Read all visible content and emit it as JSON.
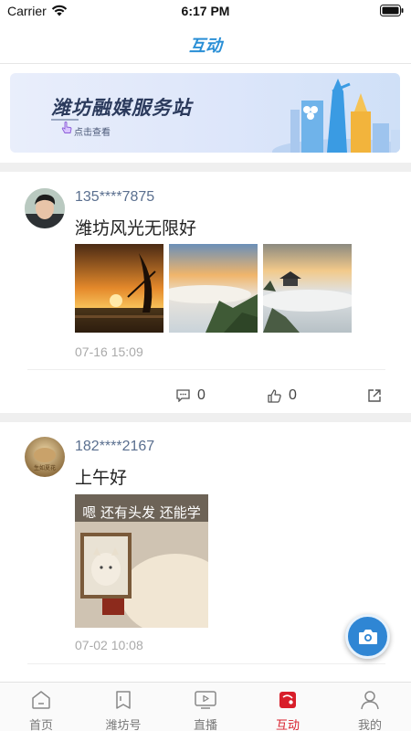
{
  "status_bar": {
    "carrier": "Carrier",
    "time": "6:17 PM"
  },
  "nav": {
    "title": "互动"
  },
  "banner": {
    "title": "潍坊融媒服务站",
    "subtitle": "点击查看"
  },
  "posts": [
    {
      "username": "135****7875",
      "text": "潍坊风光无限好",
      "time": "07-16 15:09",
      "comments": "0",
      "likes": "0",
      "images": [
        "sunset-harbor-sail",
        "sea-of-clouds-mountain",
        "pavilion-in-mist"
      ]
    },
    {
      "username": "182****2167",
      "text": "上午好",
      "time": "07-02 10:08",
      "avatar_text": "生如夏花",
      "image_caption": "嗯 还有头发 还能学"
    }
  ],
  "tabs": [
    {
      "label": "首页",
      "icon": "home-icon"
    },
    {
      "label": "潍坊号",
      "icon": "bookmark-icon"
    },
    {
      "label": "直播",
      "icon": "tv-play-icon"
    },
    {
      "label": "互动",
      "icon": "interaction-icon",
      "active": true
    },
    {
      "label": "我的",
      "icon": "user-icon"
    }
  ],
  "colors": {
    "accent": "#2a8fd6",
    "active_tab": "#d81e2a",
    "username": "#5a6f8f",
    "camera": "#2f86d4"
  }
}
